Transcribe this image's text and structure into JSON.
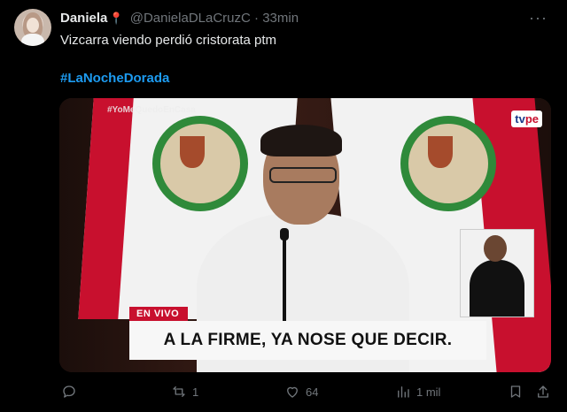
{
  "tweet": {
    "author_name": "Daniela",
    "author_emoji": "📍",
    "handle": "@DanielaDLaCruzC",
    "separator": "·",
    "time": "33min",
    "text": "Vizcarra viendo perdió cristorata ptm",
    "hashtag": "#LaNocheDorada"
  },
  "media": {
    "overlay_hashtag": "#YoMeQuedoEnCasa",
    "channel_logo_a": "tv",
    "channel_logo_b": "pe",
    "live_label": "EN VIVO",
    "caption": "A LA FIRME, YA NOSE QUE DECIR."
  },
  "actions": {
    "replies": "",
    "retweets": "1",
    "likes": "64",
    "views": "1 mil"
  },
  "colors": {
    "background": "#000000",
    "link": "#1d9bf0",
    "muted": "#71767b",
    "flag_red": "#c8102e"
  },
  "icons": [
    "reply-icon",
    "retweet-icon",
    "like-icon",
    "views-icon",
    "bookmark-icon",
    "share-icon",
    "more-icon"
  ]
}
